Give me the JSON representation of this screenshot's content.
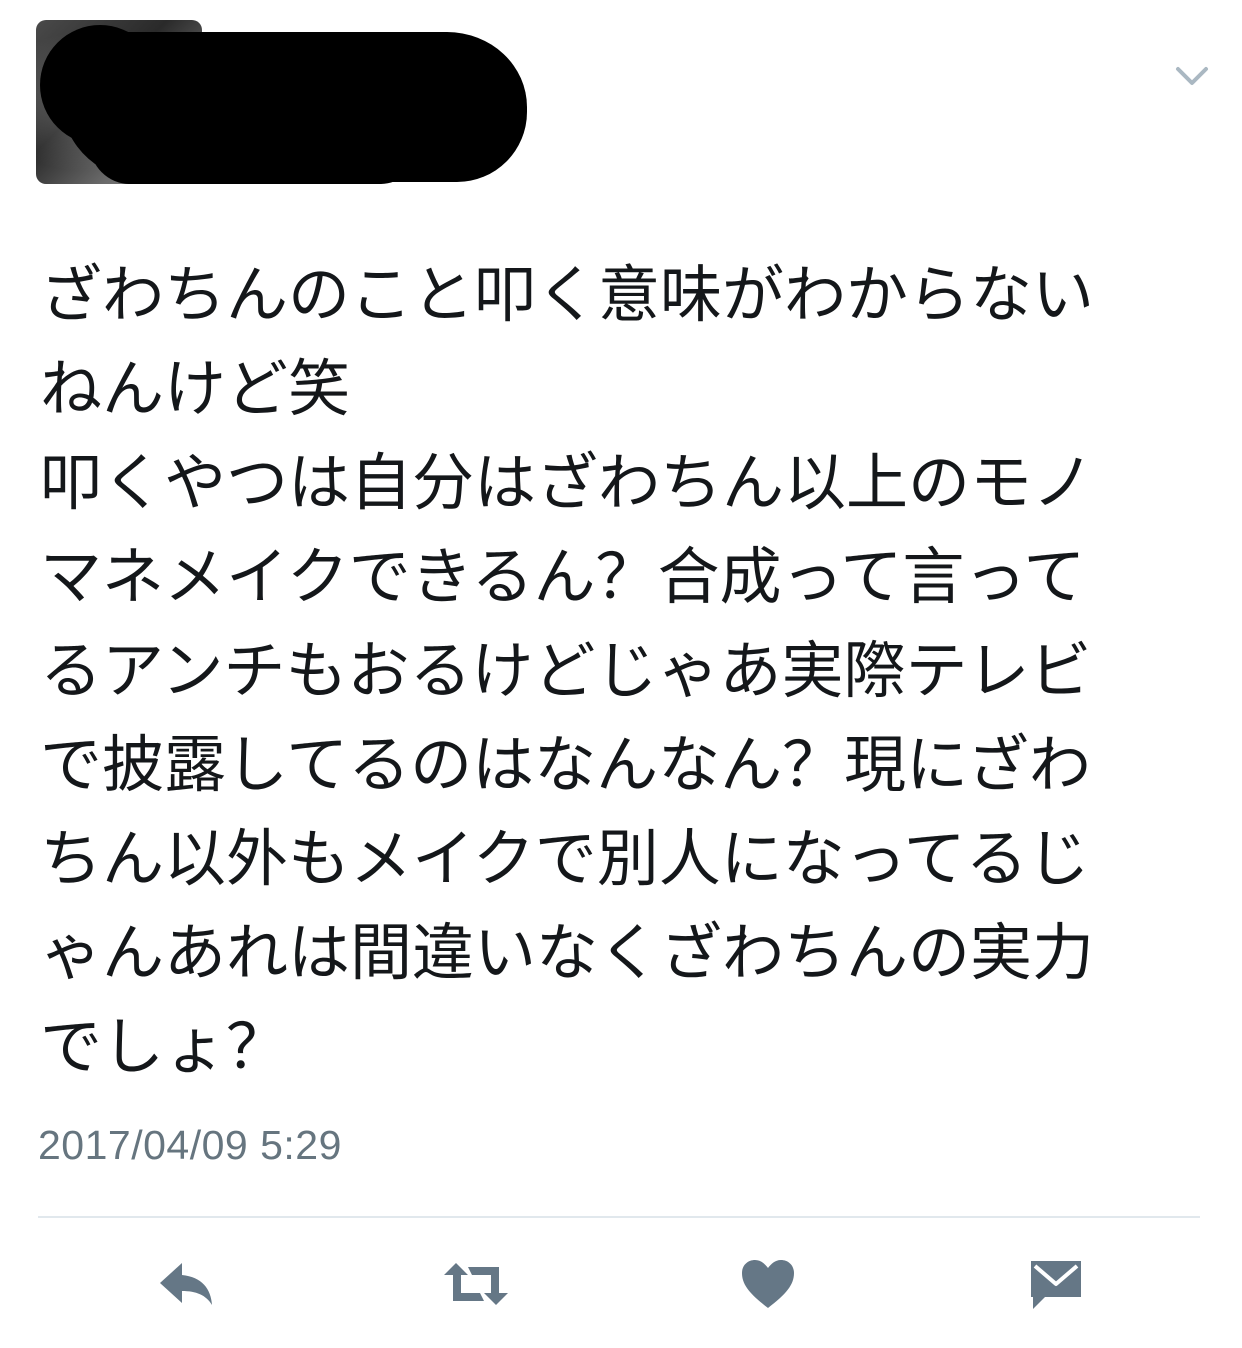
{
  "tweet": {
    "author_redacted": true,
    "text": "ざわちんのこと叩く意味がわからない\nねんけど笑\n叩くやつは自分はざわちん以上のモノ\nマネメイクできるん？合成って言って\nるアンチもおるけどじゃあ実際テレビ\nで披露してるのはなんなん？現にざわ\nちん以外もメイクで別人になってるじ\nゃんあれは間違いなくざわちんの実力\nでしょ？",
    "timestamp": "2017/04/09 5:29"
  },
  "icons": {
    "menu": "chevron-down-icon",
    "reply": "reply-icon",
    "retweet": "retweet-icon",
    "like": "heart-icon",
    "dm": "envelope-icon"
  },
  "colors": {
    "text": "#14171a",
    "meta": "#66757f",
    "icon": "#657786",
    "divider": "#e1e8ed"
  }
}
